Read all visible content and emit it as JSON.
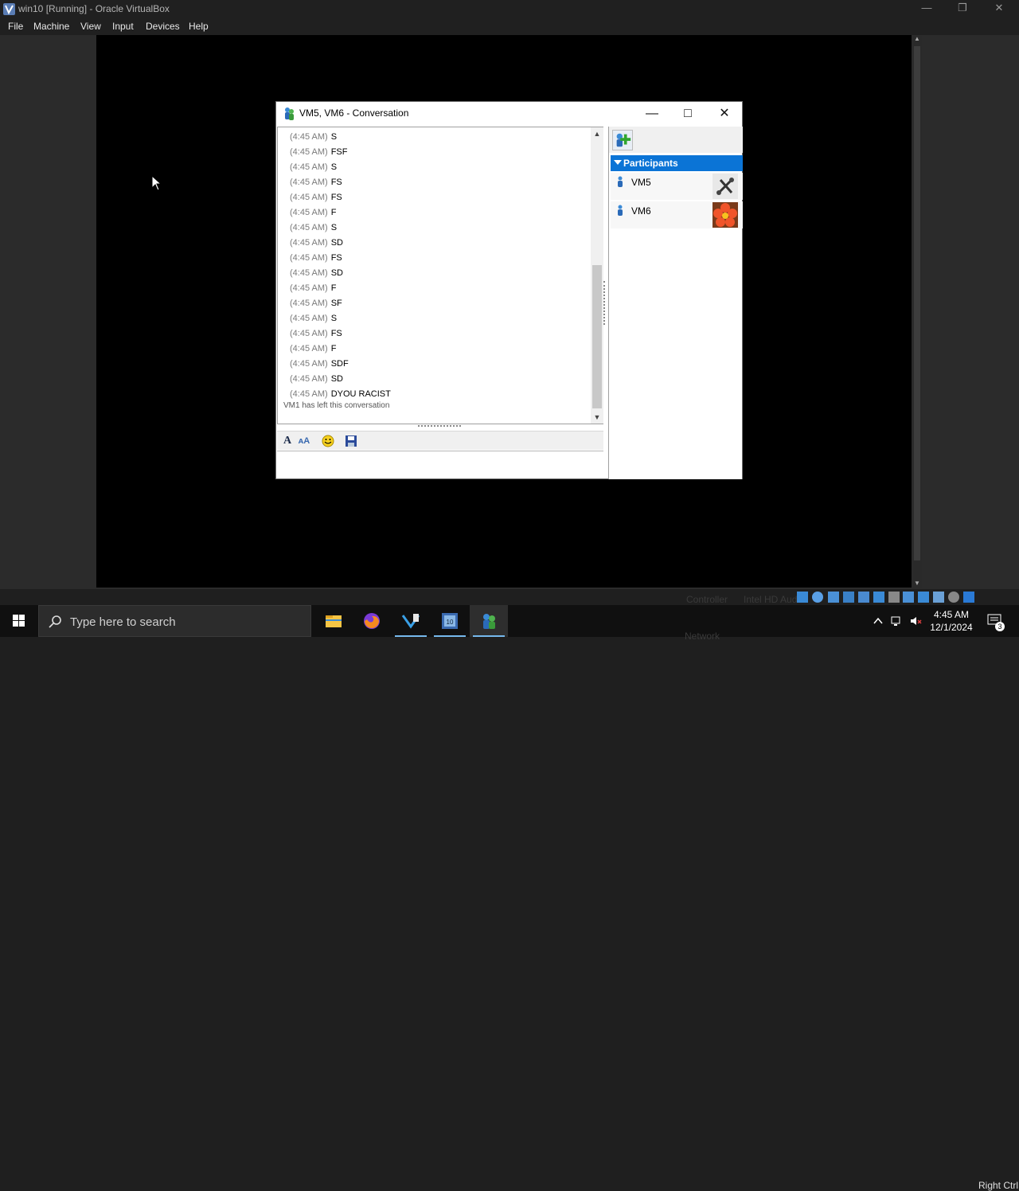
{
  "host": {
    "title": "win10 [Running] - Oracle VirtualBox",
    "menu": [
      "File",
      "Machine",
      "View",
      "Input",
      "Devices",
      "Help"
    ],
    "host_key": "Right Ctrl"
  },
  "conversation": {
    "title": "VM5, VM6 - Conversation",
    "messages": [
      {
        "time": "(4:45 AM)",
        "text": "S"
      },
      {
        "time": "(4:45 AM)",
        "text": "FSF"
      },
      {
        "time": "(4:45 AM)",
        "text": "S"
      },
      {
        "time": "(4:45 AM)",
        "text": "FS"
      },
      {
        "time": "(4:45 AM)",
        "text": "FS"
      },
      {
        "time": "(4:45 AM)",
        "text": "F"
      },
      {
        "time": "(4:45 AM)",
        "text": "S"
      },
      {
        "time": "(4:45 AM)",
        "text": "SD"
      },
      {
        "time": "(4:45 AM)",
        "text": "FS"
      },
      {
        "time": "(4:45 AM)",
        "text": "SD"
      },
      {
        "time": "(4:45 AM)",
        "text": "F"
      },
      {
        "time": "(4:45 AM)",
        "text": "SF"
      },
      {
        "time": "(4:45 AM)",
        "text": "S"
      },
      {
        "time": "(4:45 AM)",
        "text": "FS"
      },
      {
        "time": "(4:45 AM)",
        "text": "F"
      },
      {
        "time": "(4:45 AM)",
        "text": "SDF"
      },
      {
        "time": "(4:45 AM)",
        "text": "SD"
      },
      {
        "time": "(4:45 AM)",
        "text": "DYOU RACIST"
      }
    ],
    "system_message": "VM1 has left this conversation",
    "participants_header": "Participants",
    "participants": [
      {
        "name": "VM5",
        "avatar": "chess-avatar"
      },
      {
        "name": "VM6",
        "avatar": "flower-avatar"
      }
    ]
  },
  "taskbar": {
    "search_placeholder": "Type here to search",
    "time": "4:45 AM",
    "date": "12/1/2024",
    "notification_count": "3",
    "apps": [
      "file-explorer",
      "firefox",
      "visual-studio",
      "settings-app",
      "netmeeting"
    ]
  },
  "ghost_text": {
    "controller": "Controller",
    "audio": "Intel HD Audio",
    "network": "Network"
  },
  "colors": {
    "participants_header": "#0b74d6",
    "vm_background": "#000000",
    "taskbar": "#101010"
  }
}
